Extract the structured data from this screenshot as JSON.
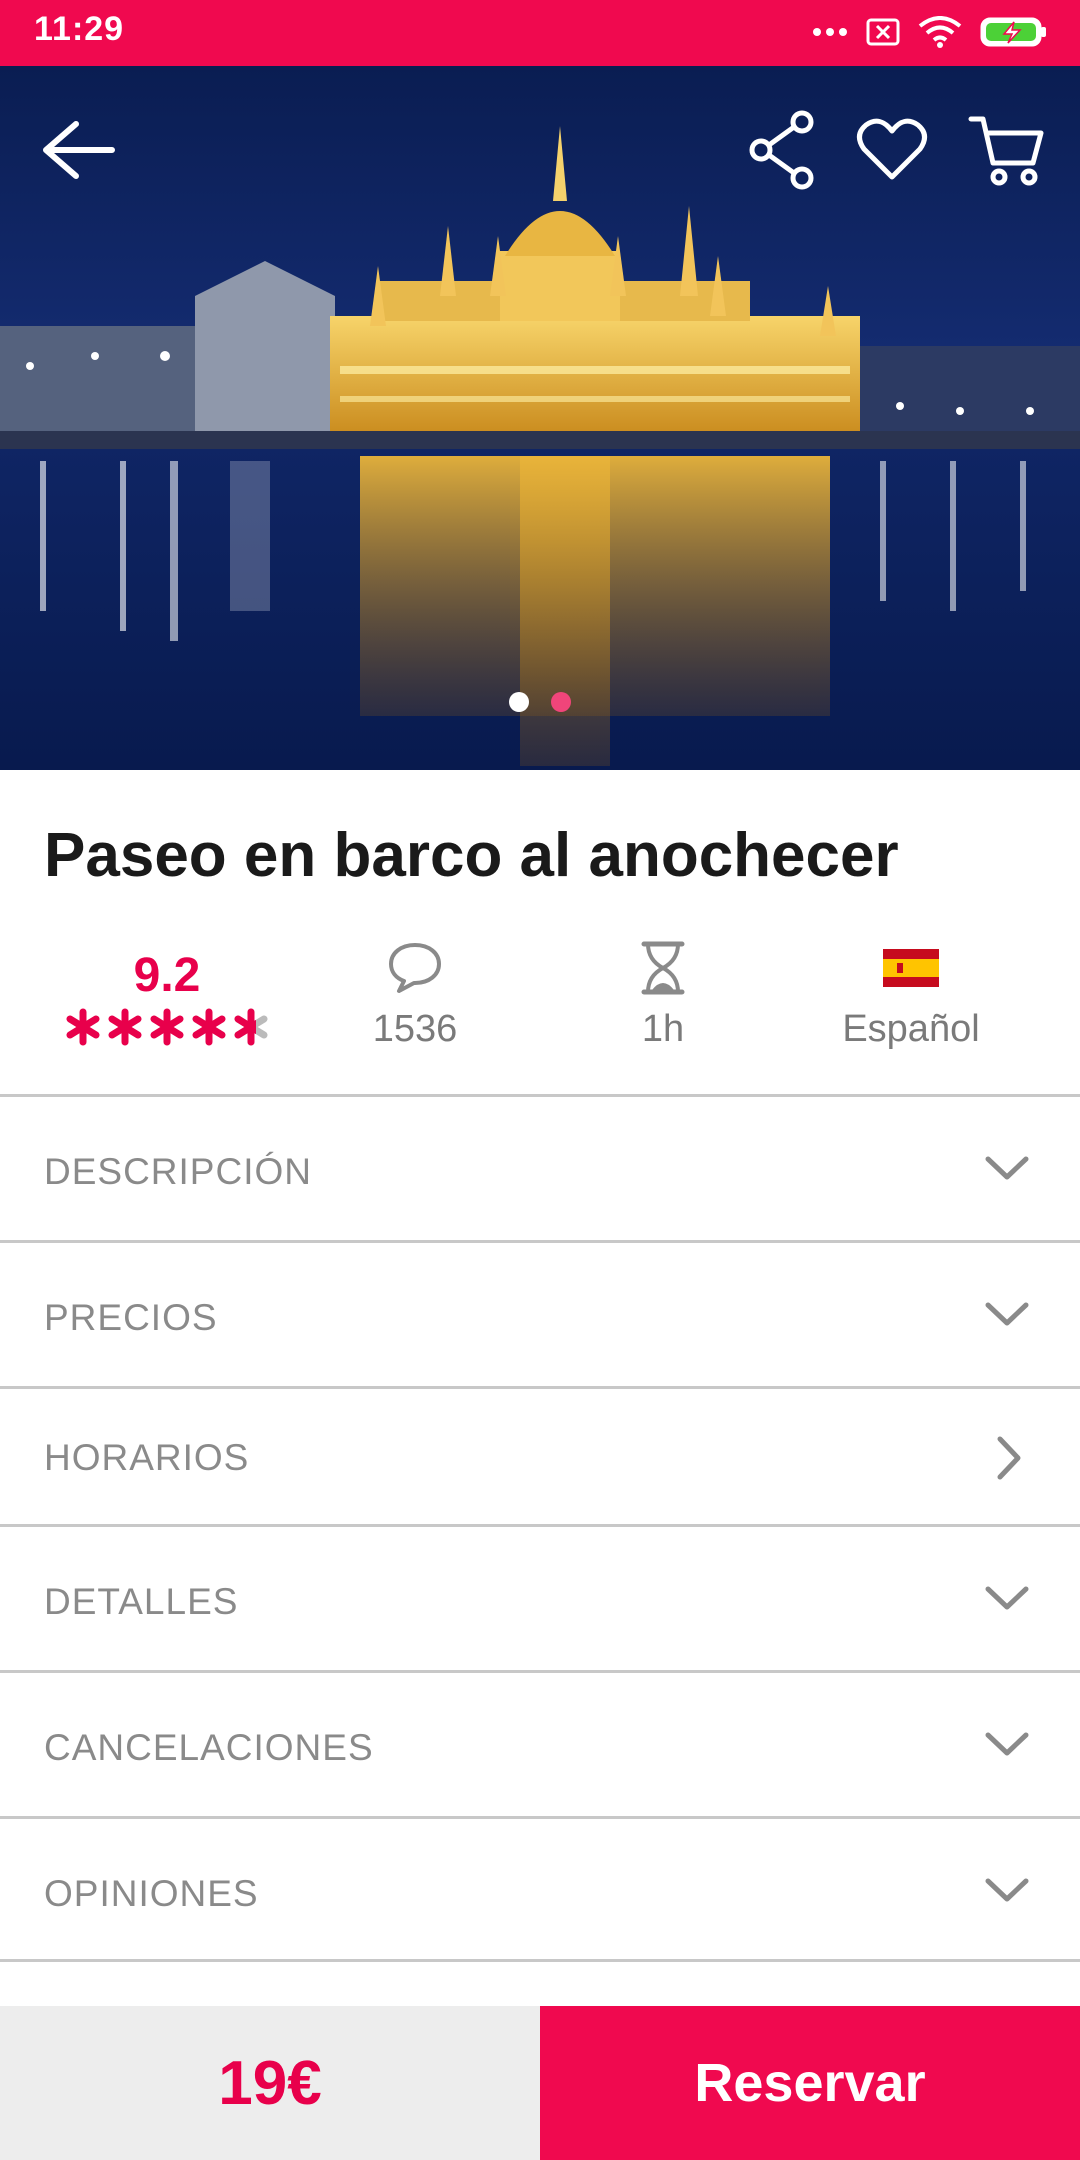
{
  "status_bar": {
    "time": "11:29",
    "icons": [
      "more-dots-icon",
      "sim-blocked-icon",
      "wifi-icon",
      "battery-charging-icon"
    ],
    "color": "#f0094f"
  },
  "hero": {
    "image": "budapest-parliament-night-photo",
    "slide_count": 2,
    "active_slide": 2,
    "actions": [
      "back-arrow-icon",
      "share-icon",
      "heart-icon",
      "cart-icon"
    ]
  },
  "title": "Paseo en barco al anochecer",
  "stats": {
    "rating": "9.2",
    "stars": 5,
    "reviews": "1536",
    "duration": "1h",
    "language": "Español",
    "language_flag": "spain-flag-icon"
  },
  "sections": [
    {
      "label": "DESCRIPCIÓN",
      "chevron": "chevron-down-icon"
    },
    {
      "label": "PRECIOS",
      "chevron": "chevron-down-icon"
    },
    {
      "label": "HORARIOS",
      "chevron": "chevron-right-icon"
    },
    {
      "label": "DETALLES",
      "chevron": "chevron-down-icon"
    },
    {
      "label": "CANCELACIONES",
      "chevron": "chevron-down-icon"
    },
    {
      "label": "OPINIONES",
      "chevron": "chevron-down-icon"
    }
  ],
  "bottom_bar": {
    "price": "19€",
    "book_label": "Reservar"
  },
  "colors": {
    "accent": "#f0094f",
    "rating": "#e8004b",
    "section_text": "#8a8a8a"
  }
}
